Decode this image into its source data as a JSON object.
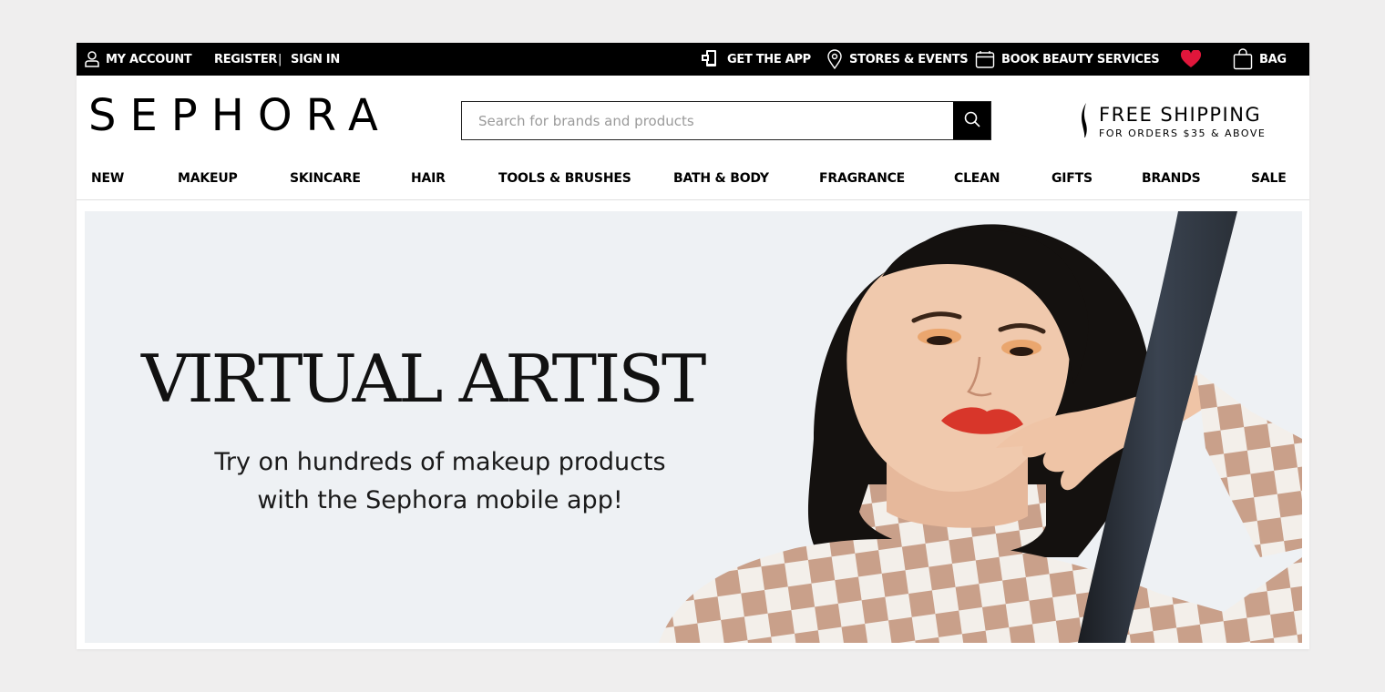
{
  "topbar": {
    "my_account": "MY ACCOUNT",
    "register": "REGISTER",
    "separator": "|",
    "sign_in": "SIGN IN",
    "get_app": "GET THE APP",
    "stores": "STORES & EVENTS",
    "book": "BOOK BEAUTY SERVICES",
    "bag": "BAG"
  },
  "header": {
    "logo": "SEPHORA",
    "search_placeholder": "Search for brands and products",
    "search_value": "",
    "shipping_title": "FREE SHIPPING",
    "shipping_sub": "FOR ORDERS $35 & ABOVE"
  },
  "nav": {
    "items": [
      "NEW",
      "MAKEUP",
      "SKINCARE",
      "HAIR",
      "TOOLS & BRUSHES",
      "BATH & BODY",
      "FRAGRANCE",
      "CLEAN",
      "GIFTS",
      "BRANDS",
      "SALE"
    ]
  },
  "hero": {
    "title": "VIRTUAL ARTIST",
    "subtitle_line1": "Try on hundreds of makeup products",
    "subtitle_line2": "with the Sephora mobile app!"
  },
  "icons": {
    "account": "person-icon",
    "app": "phone-icon",
    "stores": "location-pin-icon",
    "book": "calendar-icon",
    "loves": "heart-icon",
    "bag": "shopping-bag-icon",
    "search": "search-icon"
  },
  "colors": {
    "topbar_bg": "#000000",
    "heart": "#e0163b",
    "hero_bg": "#eef1f4"
  }
}
